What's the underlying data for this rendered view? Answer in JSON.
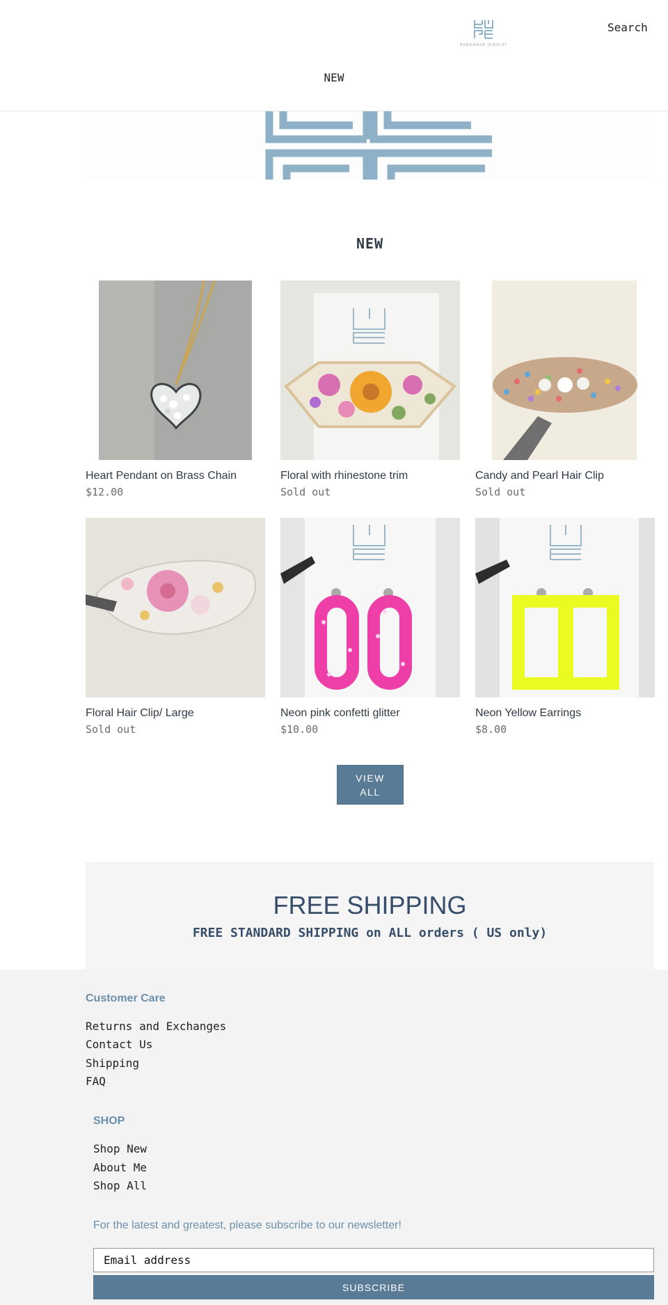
{
  "header": {
    "logo_tagline": "HANDMADE JEWELRY",
    "search_label": "Search",
    "nav_new": "NEW"
  },
  "collection": {
    "title": "NEW",
    "products": [
      {
        "title": "Heart Pendant on Brass Chain",
        "price": "$12.00"
      },
      {
        "title": "Floral with rhinestone trim",
        "price": "Sold out"
      },
      {
        "title": "Candy and Pearl Hair Clip",
        "price": "Sold out"
      },
      {
        "title": "Floral Hair Clip/ Large",
        "price": "Sold out"
      },
      {
        "title": "Neon pink confetti glitter",
        "price": "$10.00"
      },
      {
        "title": "Neon Yellow Earrings",
        "price": "$8.00"
      }
    ],
    "view_all_line1": "VIEW",
    "view_all_line2": "ALL"
  },
  "shipping": {
    "title": "FREE SHIPPING",
    "subtitle": "FREE STANDARD SHIPPING on ALL orders ( US only)"
  },
  "footer": {
    "customer_care": {
      "heading": "Customer Care",
      "links": [
        "Returns and Exchanges",
        "Contact Us",
        "Shipping",
        "FAQ"
      ]
    },
    "shop": {
      "heading": "SHOP",
      "links": [
        "Shop New",
        "About Me",
        "Shop All"
      ]
    },
    "newsletter_text": "For the latest and greatest, please subscribe to our newsletter!",
    "email_placeholder": "Email address",
    "subscribe_label": "SUBSCRIBE"
  },
  "colors": {
    "accent": "#5a7b96",
    "heading_blue": "#364e6a",
    "footer_link_blue": "#6b8fab"
  }
}
